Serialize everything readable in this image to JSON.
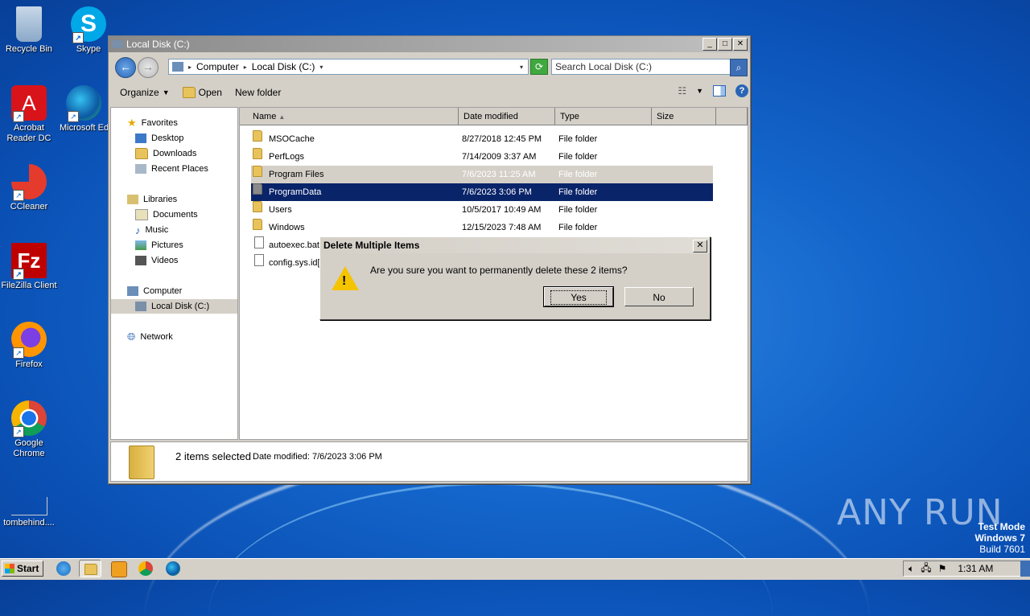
{
  "desktop": {
    "icons": [
      {
        "label": "Recycle Bin"
      },
      {
        "label": "Skype"
      },
      {
        "label": "Acrobat Reader DC"
      },
      {
        "label": "Microsoft Ed"
      },
      {
        "label": "CCleaner"
      },
      {
        "label": "FileZilla Client"
      },
      {
        "label": "Firefox"
      },
      {
        "label": "Google Chrome"
      },
      {
        "label": "tombehind...."
      }
    ],
    "watermark": "ANY RUN",
    "test_mode": {
      "line1": "Test Mode",
      "line2": "Windows 7",
      "line3": "Build 7601"
    }
  },
  "explorer": {
    "title": "Local Disk (C:)",
    "address": {
      "seg1": "Computer",
      "seg2": "Local Disk (C:)"
    },
    "search_placeholder": "Search Local Disk (C:)",
    "toolbar": {
      "organize": "Organize",
      "open": "Open",
      "new_folder": "New folder"
    },
    "nav": {
      "favorites": "Favorites",
      "desktop": "Desktop",
      "downloads": "Downloads",
      "recent": "Recent Places",
      "libraries": "Libraries",
      "documents": "Documents",
      "music": "Music",
      "pictures": "Pictures",
      "videos": "Videos",
      "computer": "Computer",
      "local_disk": "Local Disk (C:)",
      "network": "Network"
    },
    "columns": {
      "name": "Name",
      "date": "Date modified",
      "type": "Type",
      "size": "Size"
    },
    "rows": [
      {
        "name": "MSOCache",
        "date": "8/27/2018 12:45 PM",
        "type": "File folder"
      },
      {
        "name": "PerfLogs",
        "date": "7/14/2009 3:37 AM",
        "type": "File folder"
      },
      {
        "name": "Program Files",
        "date": "7/6/2023 11:25 AM",
        "type": "File folder"
      },
      {
        "name": "ProgramData",
        "date": "7/6/2023 3:06 PM",
        "type": "File folder"
      },
      {
        "name": "Users",
        "date": "10/5/2017 10:49 AM",
        "type": "File folder"
      },
      {
        "name": "Windows",
        "date": "12/15/2023 7:48 AM",
        "type": "File folder"
      },
      {
        "name": "autoexec.bat",
        "date": "",
        "type": ""
      },
      {
        "name": "config.sys.id[",
        "date": "",
        "type": ""
      }
    ],
    "status": {
      "selected": "2 items selected",
      "modified_label": "Date modified:",
      "modified_value": "7/6/2023 3:06 PM"
    }
  },
  "dialog": {
    "title": "Delete Multiple Items",
    "message": "Are you sure you want to permanently delete these 2 items?",
    "yes": "Yes",
    "no": "No"
  },
  "taskbar": {
    "start": "Start",
    "clock": "1:31 AM"
  }
}
